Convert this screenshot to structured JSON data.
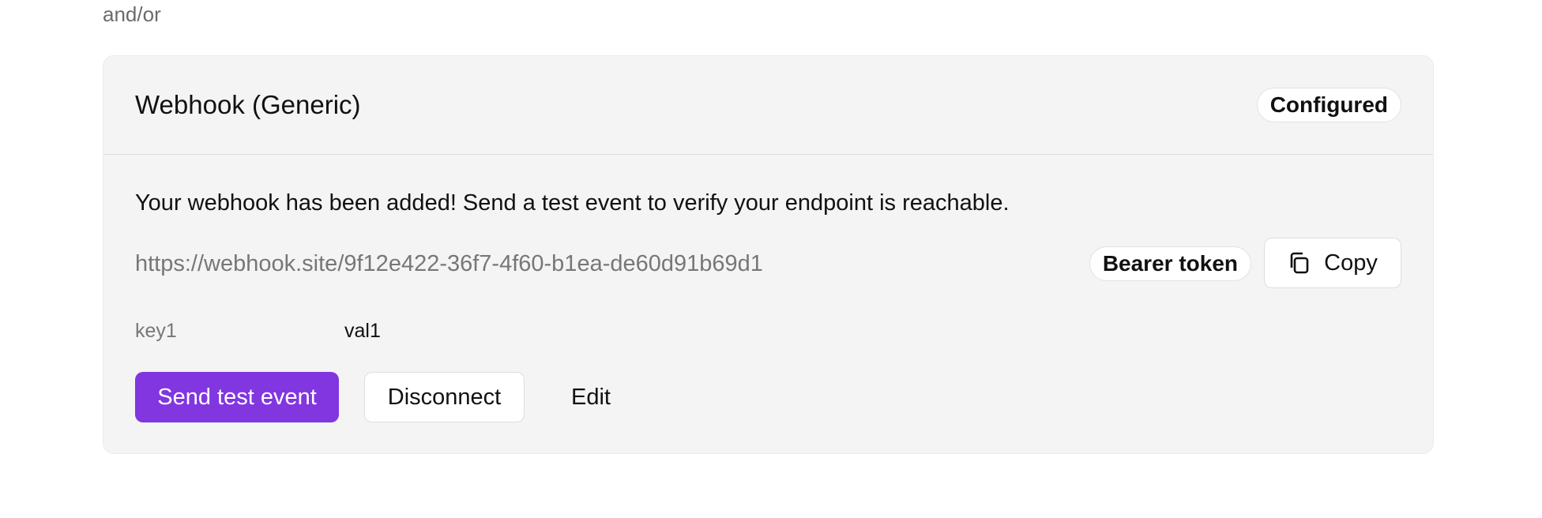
{
  "separator_text": "and/or",
  "card": {
    "title": "Webhook (Generic)",
    "status_badge": "Configured",
    "message": "Your webhook has been added! Send a test event to verify your endpoint is reachable.",
    "url": "https://webhook.site/9f12e422-36f7-4f60-b1ea-de60d91b69d1",
    "auth_badge": "Bearer token",
    "copy_label": "Copy",
    "copy_icon": "copy-icon",
    "headers": [
      {
        "key": "key1",
        "value": "val1"
      }
    ],
    "actions": {
      "send_test_label": "Send test event",
      "disconnect_label": "Disconnect",
      "edit_label": "Edit"
    }
  },
  "colors": {
    "primary": "#8136e0",
    "card_background": "#f4f4f4",
    "muted_text": "#777777"
  }
}
